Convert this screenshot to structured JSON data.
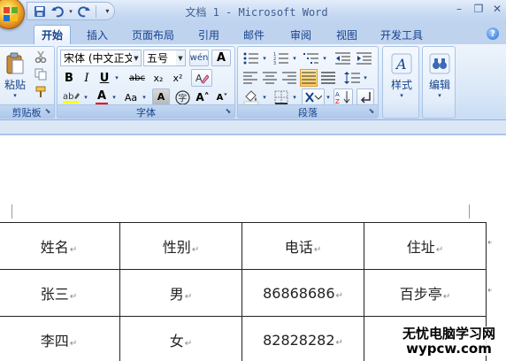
{
  "window": {
    "title": "文档 1 - Microsoft Word",
    "minimize": "–",
    "restore": "❐",
    "close": "✕"
  },
  "tabs": [
    {
      "label": "开始",
      "active": true
    },
    {
      "label": "插入"
    },
    {
      "label": "页面布局"
    },
    {
      "label": "引用"
    },
    {
      "label": "邮件"
    },
    {
      "label": "审阅"
    },
    {
      "label": "视图"
    },
    {
      "label": "开发工具"
    }
  ],
  "ribbon": {
    "clipboard": {
      "label": "剪贴板",
      "paste": "粘贴"
    },
    "font": {
      "label": "字体",
      "font_name": "宋体 (中文正文)",
      "font_size": "五号",
      "bold": "B",
      "italic": "I",
      "underline": "U",
      "strike": "abc",
      "subscript": "x₂",
      "superscript": "x²",
      "text_color": "A",
      "change_case": "Aa",
      "grow": "A˄",
      "shrink": "A˅",
      "char_shading": "A",
      "enclose": "字",
      "clear_format": "A"
    },
    "paragraph": {
      "label": "段落"
    },
    "styles": {
      "label": "样式"
    },
    "editing": {
      "label": "编辑"
    }
  },
  "document": {
    "paragraph_mark": "↵",
    "table": [
      [
        "姓名",
        "性别",
        "电话",
        "住址"
      ],
      [
        "张三",
        "男",
        "86868686",
        "百步亭"
      ],
      [
        "李四",
        "女",
        "82828282",
        ""
      ]
    ]
  },
  "watermark": {
    "line1": "无忧电脑学习网",
    "line2": "wypcw.com"
  },
  "colors": {
    "accent": "#15428b",
    "ribbon": "#dbe8f8",
    "workspace": "#a9c3e6"
  }
}
